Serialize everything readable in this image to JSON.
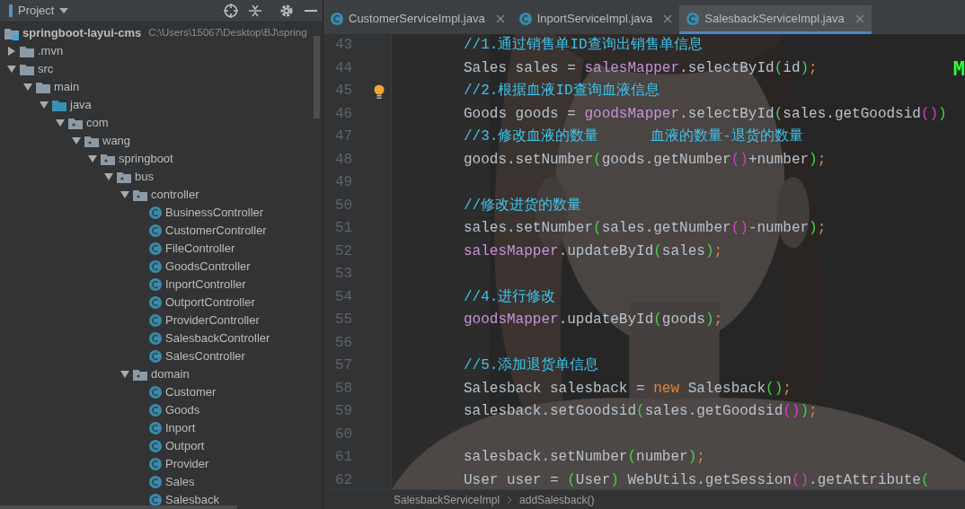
{
  "project_panel": {
    "title": "Project",
    "tree": [
      {
        "label": "springboot-layui-cms",
        "path": "C:\\Users\\15067\\Desktop\\BJ\\spring",
        "kind": "module",
        "children": [
          {
            "label": ".mvn",
            "kind": "folder",
            "expanded": false
          },
          {
            "label": "src",
            "kind": "folder",
            "expanded": true,
            "children": [
              {
                "label": "main",
                "kind": "folder",
                "expanded": true,
                "children": [
                  {
                    "label": "java",
                    "kind": "source",
                    "expanded": true,
                    "children": [
                      {
                        "label": "com",
                        "kind": "package",
                        "expanded": true,
                        "children": [
                          {
                            "label": "wang",
                            "kind": "package",
                            "expanded": true,
                            "children": [
                              {
                                "label": "springboot",
                                "kind": "package",
                                "expanded": true,
                                "children": [
                                  {
                                    "label": "bus",
                                    "kind": "package",
                                    "expanded": true,
                                    "children": [
                                      {
                                        "label": "controller",
                                        "kind": "package",
                                        "expanded": true,
                                        "children": [
                                          {
                                            "label": "BusinessController",
                                            "kind": "class"
                                          },
                                          {
                                            "label": "CustomerController",
                                            "kind": "class"
                                          },
                                          {
                                            "label": "FileController",
                                            "kind": "class"
                                          },
                                          {
                                            "label": "GoodsController",
                                            "kind": "class"
                                          },
                                          {
                                            "label": "InportController",
                                            "kind": "class"
                                          },
                                          {
                                            "label": "OutportController",
                                            "kind": "class"
                                          },
                                          {
                                            "label": "ProviderController",
                                            "kind": "class"
                                          },
                                          {
                                            "label": "SalesbackController",
                                            "kind": "class"
                                          },
                                          {
                                            "label": "SalesController",
                                            "kind": "class"
                                          }
                                        ]
                                      },
                                      {
                                        "label": "domain",
                                        "kind": "package",
                                        "expanded": true,
                                        "children": [
                                          {
                                            "label": "Customer",
                                            "kind": "class"
                                          },
                                          {
                                            "label": "Goods",
                                            "kind": "class"
                                          },
                                          {
                                            "label": "Inport",
                                            "kind": "class"
                                          },
                                          {
                                            "label": "Outport",
                                            "kind": "class"
                                          },
                                          {
                                            "label": "Provider",
                                            "kind": "class"
                                          },
                                          {
                                            "label": "Sales",
                                            "kind": "class"
                                          },
                                          {
                                            "label": "Salesback",
                                            "kind": "class"
                                          }
                                        ]
                                      }
                                    ]
                                  }
                                ]
                              }
                            ]
                          }
                        ]
                      }
                    ]
                  }
                ]
              }
            ]
          }
        ]
      }
    ]
  },
  "editor": {
    "tabs": [
      {
        "label": "CustomerServiceImpl.java",
        "selected": false
      },
      {
        "label": "InportServiceImpl.java",
        "selected": false
      },
      {
        "label": "SalesbackServiceImpl.java",
        "selected": true
      }
    ],
    "overlay_text": "M",
    "lines": [
      {
        "number": "43",
        "tokens": [
          {
            "text": "//1.通过销售单ID查询出销售单信息",
            "kind": "comment"
          }
        ]
      },
      {
        "number": "44",
        "tokens": [
          {
            "text": "Sales sales = ",
            "kind": "plain"
          },
          {
            "text": "salesMapper",
            "kind": "field"
          },
          {
            "text": ".selectById",
            "kind": "plain"
          },
          {
            "text": "(",
            "kind": "paren"
          },
          {
            "text": "id",
            "kind": "plain"
          },
          {
            "text": ")",
            "kind": "paren"
          },
          {
            "text": ";",
            "kind": "semi"
          }
        ]
      },
      {
        "number": "45",
        "bulb": true,
        "tokens": [
          {
            "text": "//2.根据血液ID查询血液信息",
            "kind": "comment"
          }
        ]
      },
      {
        "number": "46",
        "tokens": [
          {
            "text": "Goods goods = ",
            "kind": "plain"
          },
          {
            "text": "goodsMapper",
            "kind": "field"
          },
          {
            "text": ".selectById",
            "kind": "plain"
          },
          {
            "text": "(",
            "kind": "paren"
          },
          {
            "text": "sales.getGoodsid",
            "kind": "plain"
          },
          {
            "text": "()",
            "kind": "paren2"
          },
          {
            "text": ")",
            "kind": "paren"
          }
        ]
      },
      {
        "number": "47",
        "tokens": [
          {
            "text": "//3.修改血液的数量      血液的数量-退货的数量",
            "kind": "comment"
          }
        ]
      },
      {
        "number": "48",
        "tokens": [
          {
            "text": "goods.setNumber",
            "kind": "plain"
          },
          {
            "text": "(",
            "kind": "paren"
          },
          {
            "text": "goods.getNumber",
            "kind": "plain"
          },
          {
            "text": "()",
            "kind": "paren2"
          },
          {
            "text": "+number",
            "kind": "plain"
          },
          {
            "text": ")",
            "kind": "paren"
          },
          {
            "text": ";",
            "kind": "semi"
          }
        ]
      },
      {
        "number": "49"
      },
      {
        "number": "50",
        "tokens": [
          {
            "text": "//修改进货的数量",
            "kind": "comment"
          }
        ]
      },
      {
        "number": "51",
        "tokens": [
          {
            "text": "sales.setNumber",
            "kind": "plain"
          },
          {
            "text": "(",
            "kind": "paren"
          },
          {
            "text": "sales.getNumber",
            "kind": "plain"
          },
          {
            "text": "()",
            "kind": "paren2"
          },
          {
            "text": "-number",
            "kind": "plain"
          },
          {
            "text": ")",
            "kind": "paren"
          },
          {
            "text": ";",
            "kind": "semi"
          }
        ]
      },
      {
        "number": "52",
        "tokens": [
          {
            "text": "salesMapper",
            "kind": "field"
          },
          {
            "text": ".updateById",
            "kind": "plain"
          },
          {
            "text": "(",
            "kind": "paren"
          },
          {
            "text": "sales",
            "kind": "plain"
          },
          {
            "text": ")",
            "kind": "paren"
          },
          {
            "text": ";",
            "kind": "semi"
          }
        ]
      },
      {
        "number": "53"
      },
      {
        "number": "54",
        "tokens": [
          {
            "text": "//4.进行修改",
            "kind": "comment"
          }
        ]
      },
      {
        "number": "55",
        "tokens": [
          {
            "text": "goodsMapper",
            "kind": "field"
          },
          {
            "text": ".updateById",
            "kind": "plain"
          },
          {
            "text": "(",
            "kind": "paren"
          },
          {
            "text": "goods",
            "kind": "plain"
          },
          {
            "text": ")",
            "kind": "paren"
          },
          {
            "text": ";",
            "kind": "semi"
          }
        ]
      },
      {
        "number": "56"
      },
      {
        "number": "57",
        "tokens": [
          {
            "text": "//5.添加退货单信息",
            "kind": "comment"
          }
        ]
      },
      {
        "number": "58",
        "tokens": [
          {
            "text": "Salesback salesback = ",
            "kind": "plain"
          },
          {
            "text": "new",
            "kind": "keyword"
          },
          {
            "text": " Salesback",
            "kind": "plain"
          },
          {
            "text": "()",
            "kind": "paren"
          },
          {
            "text": ";",
            "kind": "semi"
          }
        ]
      },
      {
        "number": "59",
        "tokens": [
          {
            "text": "salesback.setGoodsid",
            "kind": "plain"
          },
          {
            "text": "(",
            "kind": "paren"
          },
          {
            "text": "sales.getGoodsid",
            "kind": "plain"
          },
          {
            "text": "()",
            "kind": "paren2"
          },
          {
            "text": ")",
            "kind": "paren"
          },
          {
            "text": ";",
            "kind": "semi"
          }
        ]
      },
      {
        "number": "60"
      },
      {
        "number": "61",
        "tokens": [
          {
            "text": "salesback.setNumber",
            "kind": "plain"
          },
          {
            "text": "(",
            "kind": "paren"
          },
          {
            "text": "number",
            "kind": "plain"
          },
          {
            "text": ")",
            "kind": "paren"
          },
          {
            "text": ";",
            "kind": "semi"
          }
        ]
      },
      {
        "number": "62",
        "tokens": [
          {
            "text": "User user = ",
            "kind": "plain"
          },
          {
            "text": "(",
            "kind": "paren"
          },
          {
            "text": "User",
            "kind": "plain"
          },
          {
            "text": ")",
            "kind": "paren"
          },
          {
            "text": " WebUtils.getSession",
            "kind": "plain"
          },
          {
            "text": "()",
            "kind": "paren2"
          },
          {
            "text": ".getAttribute",
            "kind": "plain"
          },
          {
            "text": "(",
            "kind": "paren"
          }
        ]
      }
    ],
    "breadcrumb": [
      "SalesbackServiceImpl",
      "addSalesback()"
    ]
  }
}
